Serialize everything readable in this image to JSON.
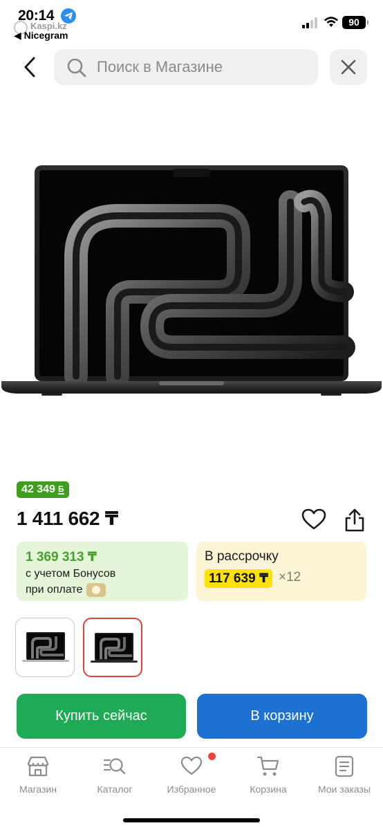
{
  "status_bar": {
    "time": "20:14",
    "back_app_name": "Kaspi.kz",
    "back_app_label": "◀ Nicegram",
    "battery": "90"
  },
  "header": {
    "search_placeholder": "Поиск в Магазине",
    "back_icon": "chevron-left-icon",
    "clear_icon": "close-icon"
  },
  "product": {
    "bonus_amount": "42 349",
    "bonus_currency": "Б",
    "price": "1 411 662 ₸",
    "bonus_card": {
      "price_with_bonus": "1 369 313 ₸",
      "line1": "с учетом Бонусов",
      "line2": "при оплате"
    },
    "installment_card": {
      "title": "В рассрочку",
      "monthly": "117 639 ₸",
      "months": "×12"
    },
    "variants_count": 2,
    "selected_variant": 2
  },
  "actions": {
    "buy_now": "Купить сейчас",
    "add_to_cart": "В корзину"
  },
  "tab_bar": {
    "items": [
      {
        "label": "Магазин",
        "icon": "store-icon"
      },
      {
        "label": "Каталог",
        "icon": "catalog-search-icon"
      },
      {
        "label": "Избранное",
        "icon": "heart-icon"
      },
      {
        "label": "Корзина",
        "icon": "cart-icon"
      },
      {
        "label": "Мои заказы",
        "icon": "orders-icon"
      }
    ]
  },
  "colors": {
    "green_bonus": "#3f9e1f",
    "buy_green": "#1fab55",
    "cart_blue": "#1c71d3",
    "installment_yellow": "#ffe10a",
    "selected_border": "#e0413a"
  }
}
